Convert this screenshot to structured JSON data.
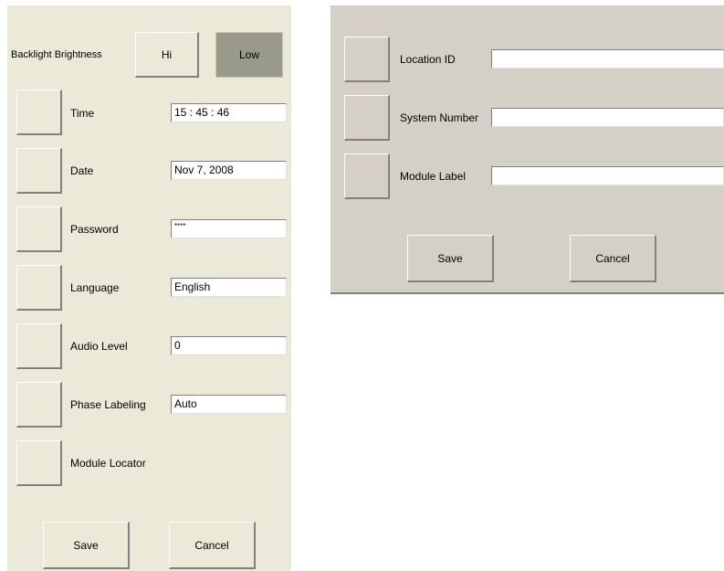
{
  "left_panel": {
    "backlight": {
      "label": "Backlight Brightness",
      "hi_label": "Hi",
      "low_label": "Low",
      "selected": "Low",
      "selected_color": "#9a9a8a"
    },
    "rows": [
      {
        "label": "Time",
        "value": "15 : 45 : 46"
      },
      {
        "label": "Date",
        "value": "Nov  7, 2008"
      },
      {
        "label": "Password",
        "value": "****"
      },
      {
        "label": "Language",
        "value": "English"
      },
      {
        "label": "Audio Level",
        "value": "0"
      },
      {
        "label": "Phase Labeling",
        "value": "Auto"
      },
      {
        "label": "Module Locator"
      }
    ],
    "save_label": "Save",
    "cancel_label": "Cancel",
    "background": "#ece9d8"
  },
  "right_panel": {
    "rows": [
      {
        "label": "Location ID",
        "value": ""
      },
      {
        "label": "System Number",
        "value": ""
      },
      {
        "label": "Module Label",
        "value": ""
      }
    ],
    "save_label": "Save",
    "cancel_label": "Cancel",
    "background": "#d4d0c8"
  }
}
